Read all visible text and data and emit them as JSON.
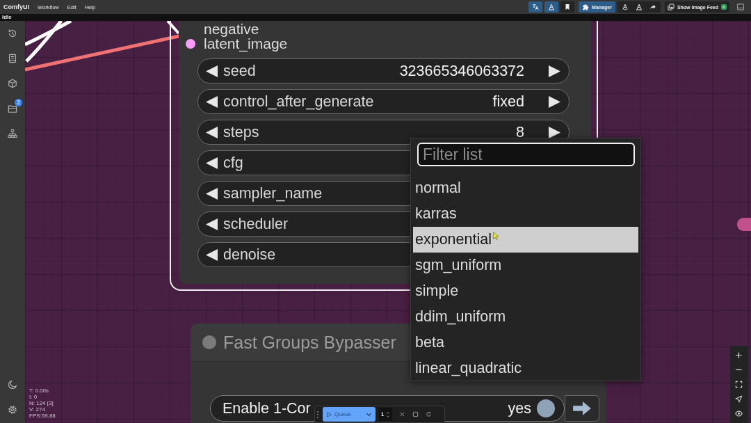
{
  "menu_bar": {
    "title": "ComfyUI",
    "menus": [
      "Workflow",
      "Edit",
      "Help"
    ],
    "manager_button": "Manager",
    "image_feed_button": "Show Image Feed"
  },
  "status": "Idle",
  "sidebar": {
    "queue_badge": "2"
  },
  "node": {
    "selected": true,
    "inputs": [
      {
        "label": "negative"
      },
      {
        "label": "latent_image",
        "color": "#ff9cf9"
      }
    ],
    "widgets": [
      {
        "label": "seed",
        "value": "323665346063372"
      },
      {
        "label": "control_after_generate",
        "value": "fixed"
      },
      {
        "label": "steps",
        "value": "8"
      },
      {
        "label": "cfg"
      },
      {
        "label": "sampler_name"
      },
      {
        "label": "scheduler"
      },
      {
        "label": "denoise"
      }
    ]
  },
  "dropdown": {
    "placeholder": "Filter list",
    "items": [
      {
        "label": "normal",
        "selected": false
      },
      {
        "label": "karras",
        "selected": false
      },
      {
        "label": "exponential",
        "selected": true
      },
      {
        "label": "sgm_uniform",
        "selected": false
      },
      {
        "label": "simple",
        "selected": false
      },
      {
        "label": "ddim_uniform",
        "selected": false
      },
      {
        "label": "beta",
        "selected": false
      },
      {
        "label": "linear_quadratic",
        "selected": false
      }
    ]
  },
  "group_node": {
    "title": "Fast Groups Bypasser",
    "toggles": [
      {
        "label": "Enable 1-Cor",
        "value": "yes",
        "on": true
      }
    ]
  },
  "queue_bar": {
    "button": "Queue",
    "count": "1"
  },
  "canvas_stats": [
    "T: 0.00s",
    "I: 0",
    "N: 124 [3]",
    "V: 274",
    "FPS:59.88"
  ]
}
